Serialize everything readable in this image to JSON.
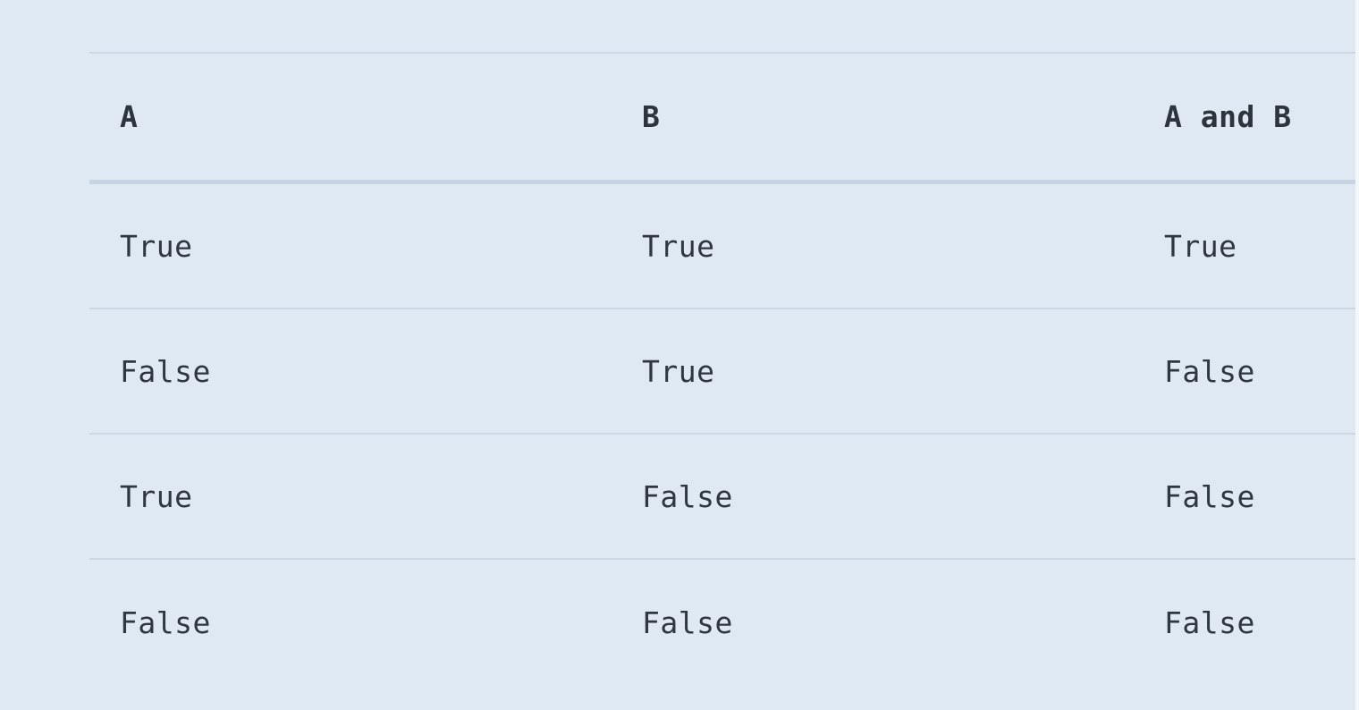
{
  "table": {
    "headers": [
      "A",
      "B",
      "A and B"
    ],
    "rows": [
      [
        "True",
        "True",
        "True"
      ],
      [
        "False",
        "True",
        "False"
      ],
      [
        "True",
        "False",
        "False"
      ],
      [
        "False",
        "False",
        "False"
      ]
    ]
  },
  "colors": {
    "background": "#dfe9f4",
    "divider": "#ccd8e5",
    "text": "#2f3740"
  }
}
